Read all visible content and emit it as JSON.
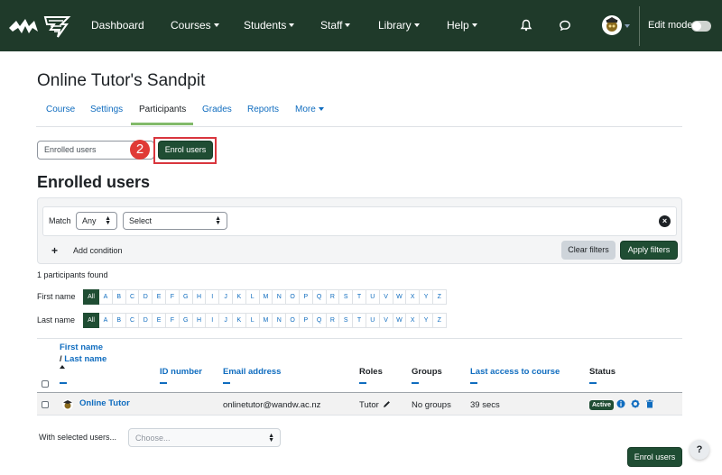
{
  "nav": {
    "items": [
      {
        "label": "Dashboard",
        "dropdown": false
      },
      {
        "label": "Courses",
        "dropdown": true
      },
      {
        "label": "Students",
        "dropdown": true
      },
      {
        "label": "Staff",
        "dropdown": true
      },
      {
        "label": "Library",
        "dropdown": true
      },
      {
        "label": "Help",
        "dropdown": true
      }
    ],
    "icons": [
      "bell-icon",
      "chat-icon"
    ],
    "edit_mode_label": "Edit mode",
    "edit_mode_on": false
  },
  "page": {
    "title": "Online Tutor's Sandpit",
    "tabs": [
      {
        "label": "Course",
        "active": false
      },
      {
        "label": "Settings",
        "active": false
      },
      {
        "label": "Participants",
        "active": true
      },
      {
        "label": "Grades",
        "active": false
      },
      {
        "label": "Reports",
        "active": false
      },
      {
        "label": "More",
        "active": false
      }
    ]
  },
  "enrol": {
    "select_value": "Enrolled users",
    "step_number": "2",
    "enrol_button": "Enrol users"
  },
  "section_title": "Enrolled users",
  "filter": {
    "match_label": "Match",
    "match_value": "Any",
    "select_value": "Select",
    "add_condition": "Add condition",
    "clear_filters": "Clear filters",
    "apply_filters": "Apply filters"
  },
  "found_text": "1 participants found",
  "initials": {
    "first_name_label": "First name",
    "last_name_label": "Last name",
    "all_label": "All",
    "letters": [
      "A",
      "B",
      "C",
      "D",
      "E",
      "F",
      "G",
      "H",
      "I",
      "J",
      "K",
      "L",
      "M",
      "N",
      "O",
      "P",
      "Q",
      "R",
      "S",
      "T",
      "U",
      "V",
      "W",
      "X",
      "Y",
      "Z"
    ]
  },
  "table": {
    "headers": {
      "first_name": "First name",
      "slash": "/ ",
      "last_name": "Last name",
      "id_number": "ID number",
      "email": "Email address",
      "roles": "Roles",
      "groups": "Groups",
      "last_access": "Last access to course",
      "status": "Status"
    },
    "rows": [
      {
        "name": "Online Tutor",
        "email": "onlinetutor@wandw.ac.nz",
        "role": "Tutor",
        "groups": "No groups",
        "last_access": "39 secs",
        "status": "Active"
      }
    ]
  },
  "footer": {
    "with_selected": "With selected users...",
    "choose_placeholder": "Choose...",
    "enrol_button": "Enrol users",
    "help": "?"
  },
  "colors": {
    "navbar": "#1f3a2a",
    "primary_button": "#1f4d33",
    "link": "#0f6cbf",
    "step_badge": "#e03a36",
    "highlight": "#d9363e",
    "tab_underline": "#82ba6a"
  }
}
